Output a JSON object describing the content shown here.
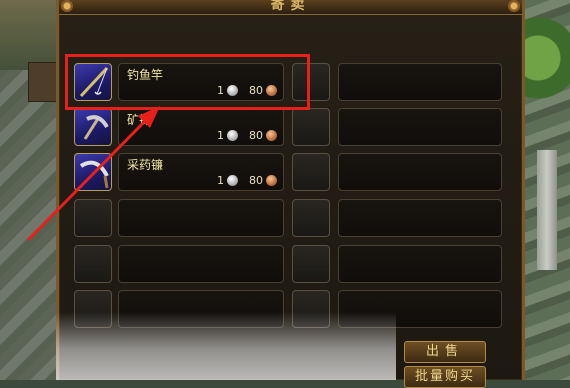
{
  "window": {
    "title": "寄卖"
  },
  "items": [
    {
      "name": "钓鱼竿",
      "silver": "1",
      "copper": "80",
      "icon": "fishing-rod-icon"
    },
    {
      "name": "矿锄",
      "silver": "1",
      "copper": "80",
      "icon": "pickaxe-icon"
    },
    {
      "name": "采药镰",
      "silver": "1",
      "copper": "80",
      "icon": "sickle-icon"
    }
  ],
  "buttons": {
    "sell": "出售",
    "bulk_buy": "批量购买"
  },
  "colors": {
    "highlight": "#e8201c",
    "item_text": "#f3e6a0",
    "button_text": "#f1d68a"
  }
}
